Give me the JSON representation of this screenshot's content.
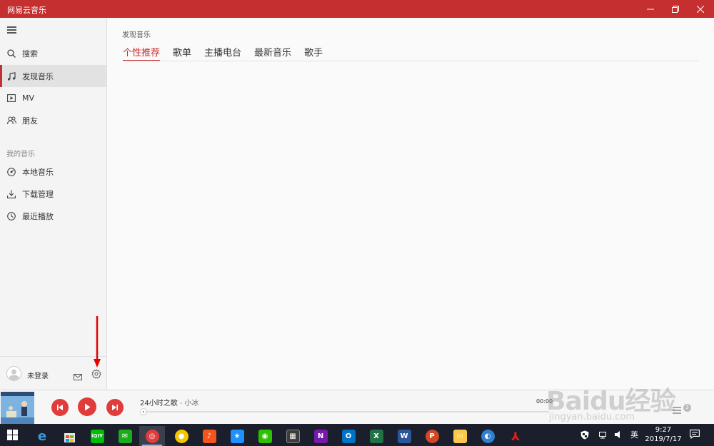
{
  "app": {
    "title": "网易云音乐"
  },
  "window_controls": {
    "minimize": "—",
    "maximize": "❐",
    "close": "✕"
  },
  "sidebar": {
    "items": [
      {
        "label": "搜索",
        "icon": "search-icon"
      },
      {
        "label": "发现音乐",
        "icon": "music-note-icon",
        "active": true
      },
      {
        "label": "MV",
        "icon": "video-icon"
      },
      {
        "label": "朋友",
        "icon": "friends-icon"
      }
    ],
    "section_label": "我的音乐",
    "my_music": [
      {
        "label": "本地音乐",
        "icon": "disc-icon"
      },
      {
        "label": "下载管理",
        "icon": "download-icon"
      },
      {
        "label": "最近播放",
        "icon": "clock-icon"
      }
    ],
    "user": {
      "name": "未登录"
    }
  },
  "main": {
    "breadcrumb": "发现音乐",
    "tabs": [
      {
        "label": "个性推荐",
        "active": true
      },
      {
        "label": "歌单"
      },
      {
        "label": "主播电台"
      },
      {
        "label": "最新音乐"
      },
      {
        "label": "歌手"
      }
    ]
  },
  "player": {
    "song_title": "24小时之歌",
    "separator": "-",
    "artist": "小冰",
    "time": "00:00",
    "playlist_count": "3",
    "progress": 0
  },
  "taskbar": {
    "ime": "英",
    "time": "9:27",
    "date": "2019/7/17",
    "apps": [
      "edge-icon",
      "store-icon",
      "iqiyi-icon",
      "wechat-work-icon",
      "netease-music-icon",
      "app-green-icon",
      "app-orange-icon",
      "app-blue-star-icon",
      "wechat-icon",
      "calculator-icon",
      "onenote-icon",
      "outlook-icon",
      "excel-icon",
      "word-icon",
      "powerpoint-icon",
      "file-explorer-icon",
      "app-globe-icon",
      "pdf-icon"
    ]
  },
  "watermark": {
    "big": "Baidu经验",
    "small": "jingyan.baidu.com"
  },
  "colors": {
    "brand_red": "#c62f2f",
    "button_red": "#e03c3c",
    "sidebar_bg": "#f4f4f5",
    "taskbar_bg": "#1a1f2b"
  }
}
